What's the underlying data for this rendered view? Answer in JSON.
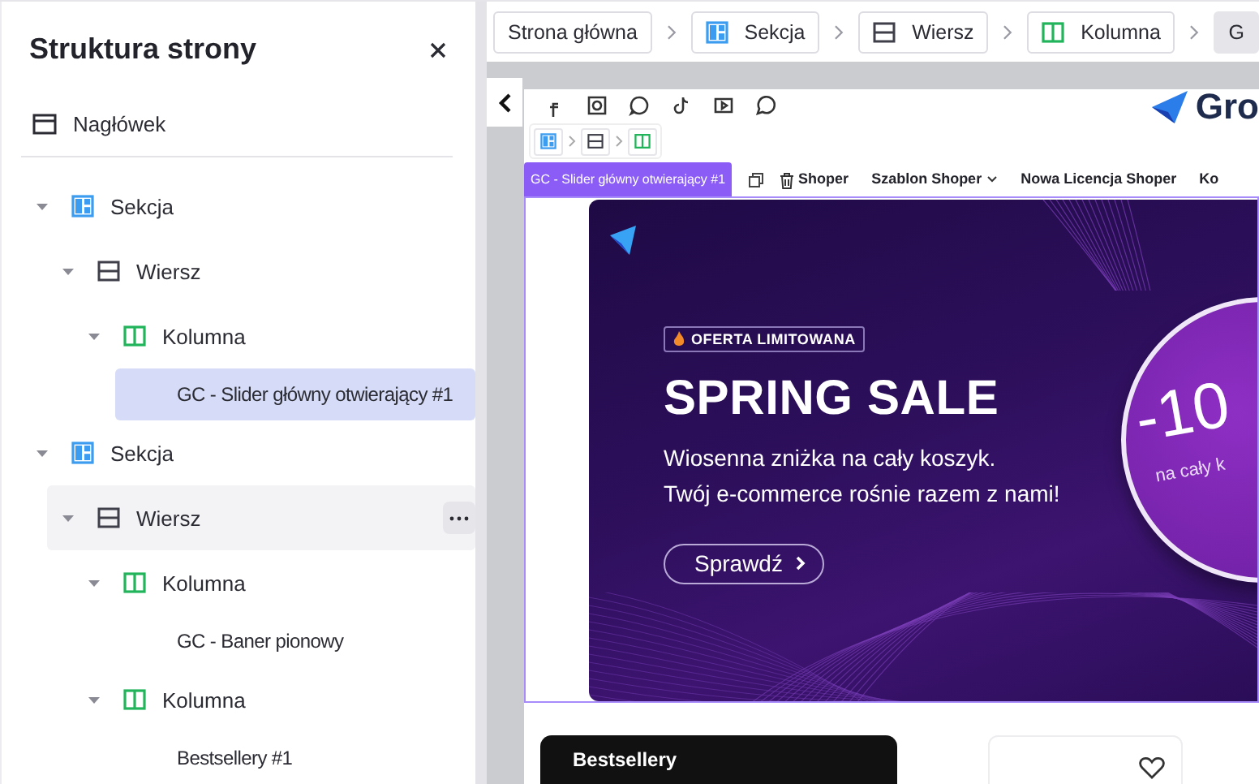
{
  "panel": {
    "title": "Struktura strony",
    "header_item": "Nagłówek"
  },
  "tree": [
    {
      "kind": "section",
      "label": "Sekcja",
      "expanded": true,
      "selected": false,
      "hovered": false,
      "children": [
        {
          "kind": "row",
          "label": "Wiersz",
          "expanded": true,
          "selected": false,
          "hovered": false,
          "children": [
            {
              "kind": "column",
              "label": "Kolumna",
              "expanded": true,
              "selected": false,
              "hovered": false,
              "children": [
                {
                  "kind": "module",
                  "label": "GC - Slider główny otwierający #1",
                  "selected": true,
                  "hovered": false
                }
              ]
            }
          ]
        }
      ]
    },
    {
      "kind": "section",
      "label": "Sekcja",
      "expanded": true,
      "selected": false,
      "hovered": false,
      "children": [
        {
          "kind": "row",
          "label": "Wiersz",
          "expanded": true,
          "selected": false,
          "hovered": true,
          "children": [
            {
              "kind": "column",
              "label": "Kolumna",
              "expanded": true,
              "selected": false,
              "hovered": false,
              "children": [
                {
                  "kind": "module",
                  "label": "GC - Baner pionowy",
                  "selected": false,
                  "hovered": false
                }
              ]
            },
            {
              "kind": "column",
              "label": "Kolumna",
              "expanded": true,
              "selected": false,
              "hovered": false,
              "children": [
                {
                  "kind": "module",
                  "label": "Bestsellery #1",
                  "selected": false,
                  "hovered": false
                }
              ]
            }
          ]
        }
      ]
    }
  ],
  "breadcrumb": [
    {
      "kind": "page",
      "label": "Strona główna",
      "selected": false
    },
    {
      "kind": "section",
      "label": "Sekcja",
      "selected": false
    },
    {
      "kind": "row",
      "label": "Wiersz",
      "selected": false
    },
    {
      "kind": "column",
      "label": "Kolumna",
      "selected": false
    },
    {
      "kind": "module",
      "label": "G",
      "selected": true
    }
  ],
  "preview": {
    "logo": "Gro",
    "element_path": [
      {
        "kind": "section"
      },
      {
        "kind": "row"
      },
      {
        "kind": "column"
      }
    ],
    "selected_label": "GC - Slider główny otwierający #1",
    "nav": [
      {
        "label": "Shoper",
        "dropdown": false
      },
      {
        "label": "Szablon Shoper",
        "dropdown": true
      },
      {
        "label": "Nowa Licencja Shoper",
        "dropdown": false
      },
      {
        "label": "Ko",
        "dropdown": false
      }
    ],
    "banner": {
      "badge": "OFERTA LIMITOWANA",
      "title": "SPRING SALE",
      "lines": [
        "Wiosenna zniżka na cały koszyk.",
        "Twój e-commerce rośnie razem z nami!"
      ],
      "button": "Sprawdź",
      "discount": "-10",
      "discount_note": "na cały k"
    },
    "bestsellers_title": "Bestsellery"
  }
}
